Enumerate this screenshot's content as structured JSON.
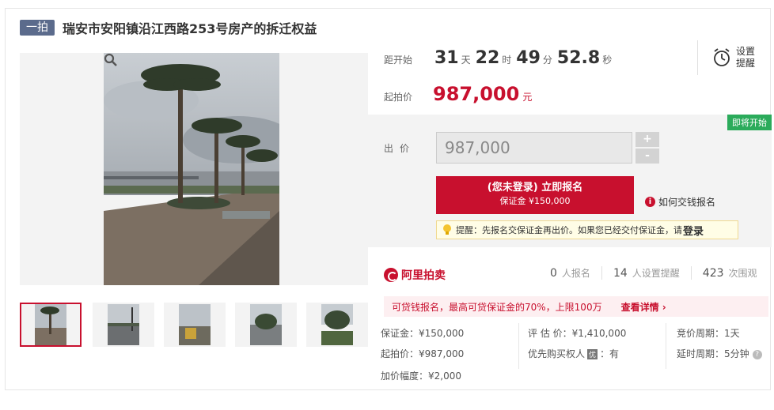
{
  "header": {
    "round_badge": "一拍",
    "title": "瑞安市安阳镇沿江西路253号房产的拆迁权益"
  },
  "countdown": {
    "label": "距开始",
    "days": "31",
    "days_unit": "天",
    "hours": "22",
    "hours_unit": "时",
    "minutes": "49",
    "minutes_unit": "分",
    "seconds": "52.8",
    "seconds_unit": "秒"
  },
  "reminder": {
    "line1": "设置",
    "line2": "提醒",
    "icon": "alarm-clock-icon"
  },
  "start_price": {
    "label": "起拍价",
    "value": "987,000",
    "unit": "元"
  },
  "bid": {
    "status_tag": "即将开始",
    "label": "出价",
    "input_value": "987,000",
    "plus": "+",
    "minus": "-",
    "signup_main": "(您未登录) 立即报名",
    "signup_sub": "保证金 ¥150,000",
    "pay_help": "如何交钱报名",
    "tip_text": "提醒：先报名交保证金再出价。如果您已经交付保证金，请",
    "tip_login": "登录"
  },
  "ali": {
    "logo": "阿里拍卖",
    "stats": [
      {
        "num": "0",
        "label": "人报名"
      },
      {
        "num": "14",
        "label": "人设置提醒"
      },
      {
        "num": "423",
        "label": "次围观"
      }
    ]
  },
  "loan": {
    "text": "可贷钱报名，最高可贷保证金的70%，上限100万",
    "link": "查看详情 ›"
  },
  "details": {
    "deposit": "保证金：¥150,000",
    "start_price": "起拍价：¥987,000",
    "increment": "加价幅度：¥2,000",
    "appraisal": "评 估 价：¥1,410,000",
    "priority_label": "优先购买权人",
    "priority_badge": "优",
    "priority_value": "：有",
    "period": "竞价周期：1天",
    "extension": "延时周期：5分钟",
    "help": "?"
  },
  "colors": {
    "accent": "#c8102e",
    "badge": "#5b6b8c",
    "soon": "#2bab5b"
  }
}
